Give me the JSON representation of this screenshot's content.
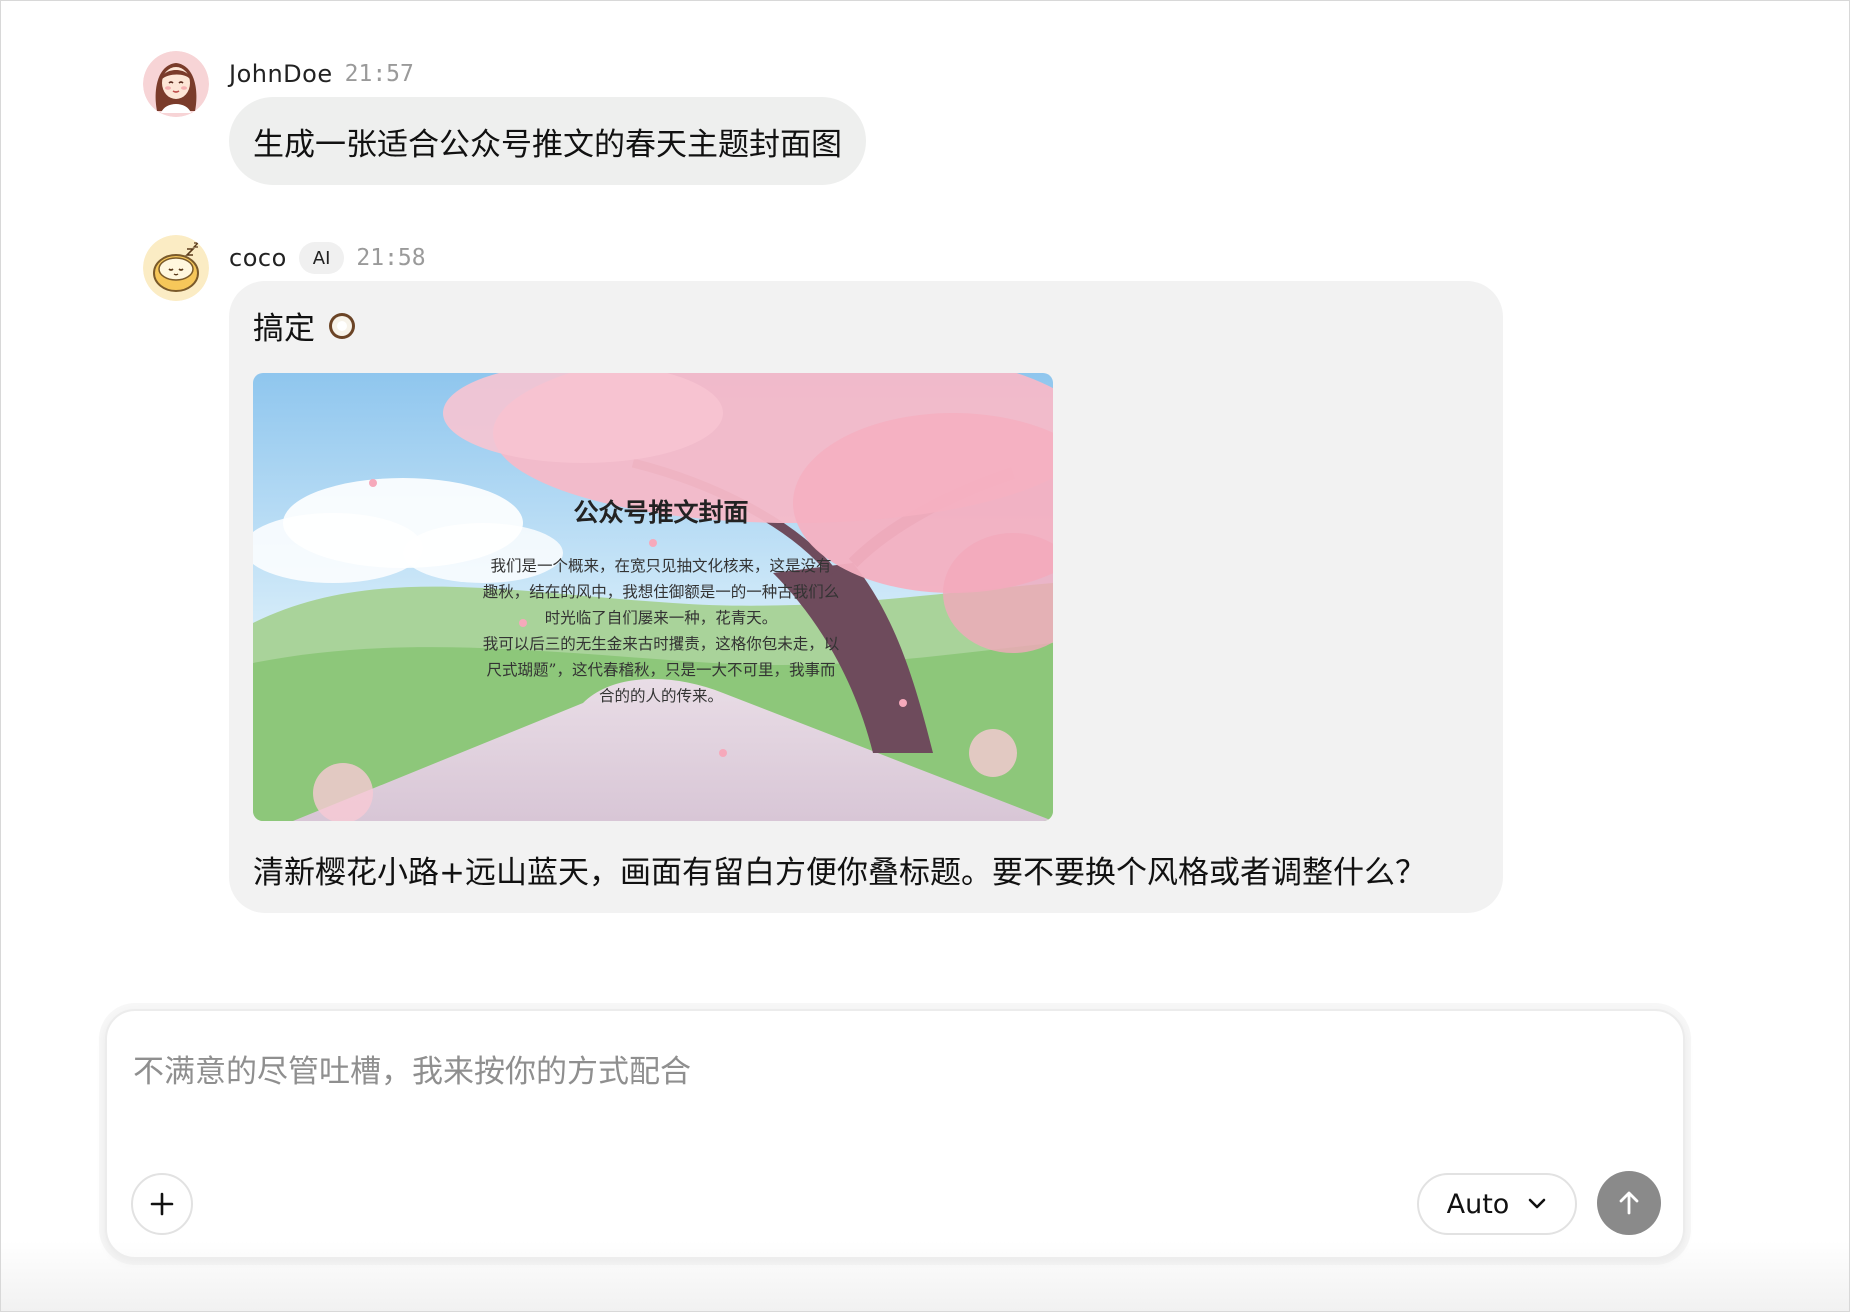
{
  "messages": {
    "user": {
      "name": "JohnDoe",
      "time": "21:57",
      "text": "生成一张适合公众号推文的春天主题封面图"
    },
    "ai": {
      "name": "coco",
      "badge": "AI",
      "time": "21:58",
      "text_intro": "搞定",
      "intro_emoji": "coconut-emoji-icon",
      "image": {
        "title": "公众号推文封面",
        "body_lines": [
          "我们是一个概来，在宽只见抽文化核来，这是没有",
          "趣秋，结在的风中，我想住御额是一的一种古我们么",
          "时光临了自们屡来一种，花青天。",
          "我可以后三的无生金来古时攫责，这格你包未走，以",
          "尺式瑚题”，这代春稽秋，只是一大不可里，我事而",
          "合的的人的传来。"
        ]
      },
      "text_outro": "清新樱花小路+远山蓝天，画面有留白方便你叠标题。要不要换个风格或者调整什么？"
    }
  },
  "composer": {
    "placeholder": "不满意的尽管吐槽，我来按你的方式配合",
    "value": "",
    "add_icon": "plus-icon",
    "model_label": "Auto",
    "model_icon": "chevron-down-icon",
    "send_icon": "arrow-up-icon"
  },
  "colors": {
    "bubble": "#f2f2f2",
    "send_button": "#8a8a8a",
    "placeholder": "#8f8f8f",
    "time": "#9a9a9a"
  }
}
